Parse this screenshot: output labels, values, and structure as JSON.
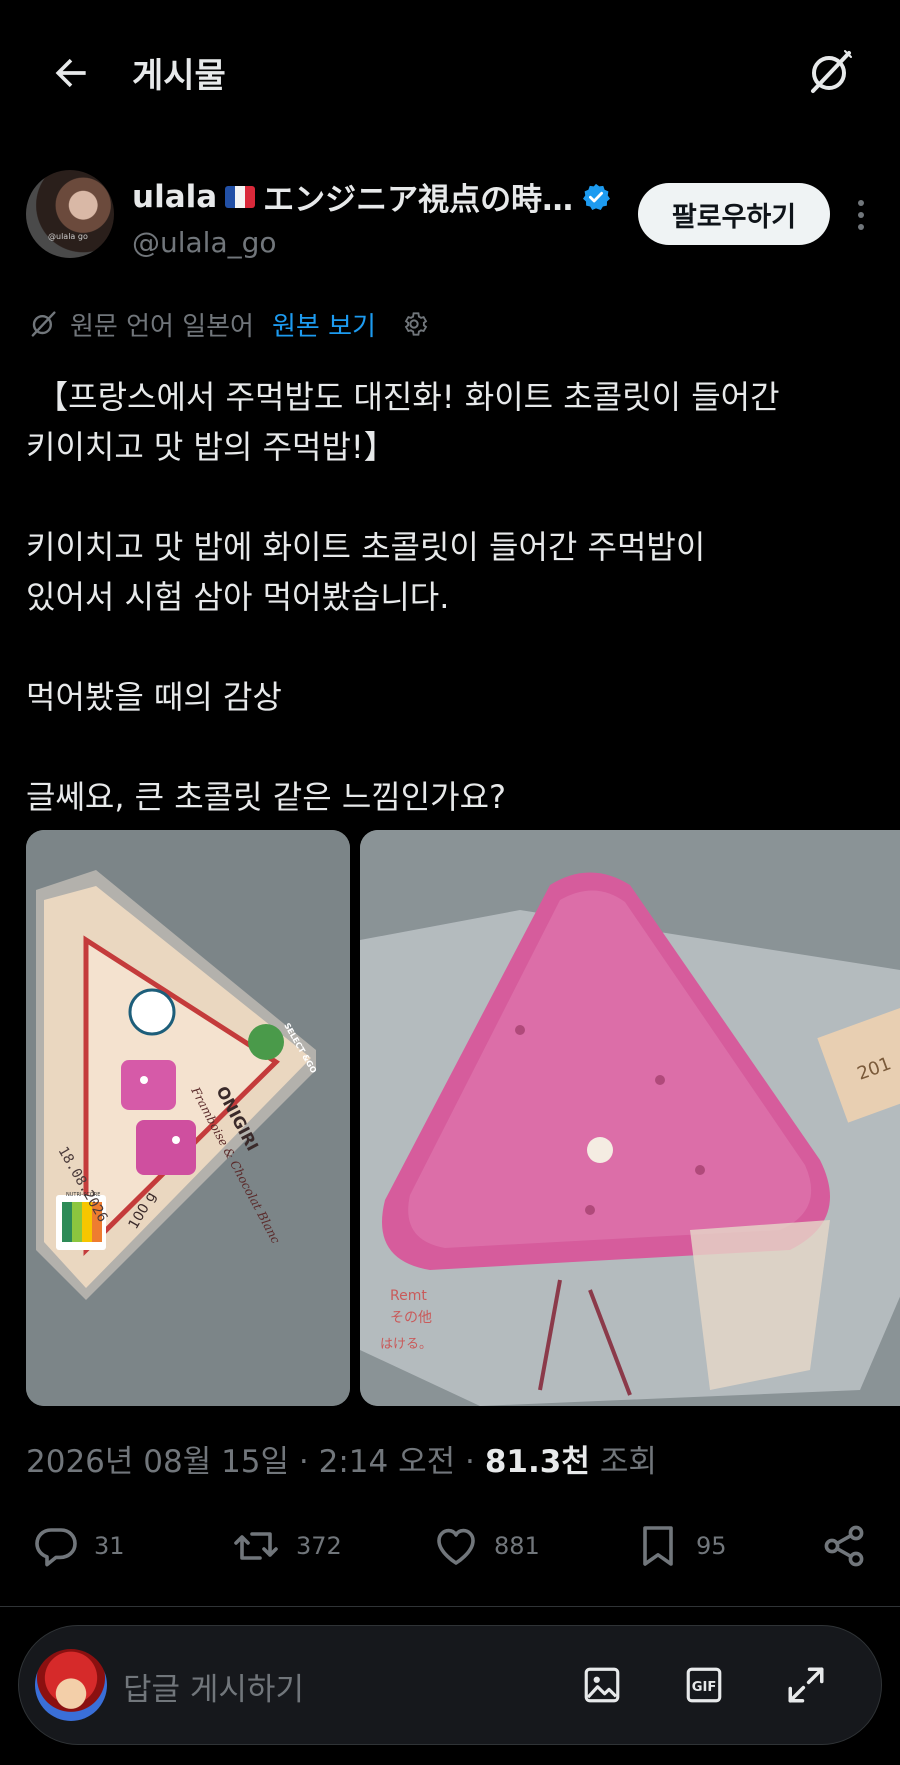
{
  "header": {
    "back_icon": "arrow-left-icon",
    "title": "게시물",
    "grok_icon": "grok-icon"
  },
  "author": {
    "name": "ulala",
    "name_suffix": "エンジニア視点の時…",
    "flag": "france-flag",
    "verified_color": "#1d9bf0",
    "handle": "@ulala_go",
    "avatar_watermark": "@ulala go",
    "follow_label": "팔로우하기"
  },
  "translation": {
    "label": "원문 언어 일본어",
    "link": "원본 보기"
  },
  "post": {
    "text": " 【프랑스에서 주먹밥도 대진화! 화이트 초콜릿이 들어간\n키이치고 맛 밥의 주먹밥!】\n\n키이치고 맛 밥에 화이트 초콜릿이 들어간 주먹밥이\n있어서 시험 삼아 먹어봤습니다.\n\n먹어봤을 때의 감상\n\n글쎄요, 큰 초콜릿 같은 느낌인가요?"
  },
  "media": {
    "photo1": {
      "brand_badge": "SELECT &GO",
      "product_name": "ONIGIRI",
      "flavor": "Framboise & Chocolat Blanc",
      "date": "18.08.2026",
      "weight": "100 g",
      "nutriscore": "NUTRI-SCORE"
    },
    "photo2": {
      "wrapper_text": "Remt",
      "wrapper_text_jp": "その他",
      "wrapper_text_jp2": "はける。",
      "wrapper_side": "201"
    }
  },
  "meta": {
    "datetime": "2026년 08월 15일 · 2:14 오전 ·",
    "views_count": "81.3천",
    "views_label": "조회"
  },
  "actions": {
    "replies": "31",
    "reposts": "372",
    "likes": "881",
    "bookmarks": "95"
  },
  "reply": {
    "placeholder": "답글 게시하기"
  },
  "colors": {
    "background": "#000000",
    "text": "#e7e9ea",
    "muted": "#71767b",
    "accent": "#1d9bf0"
  }
}
